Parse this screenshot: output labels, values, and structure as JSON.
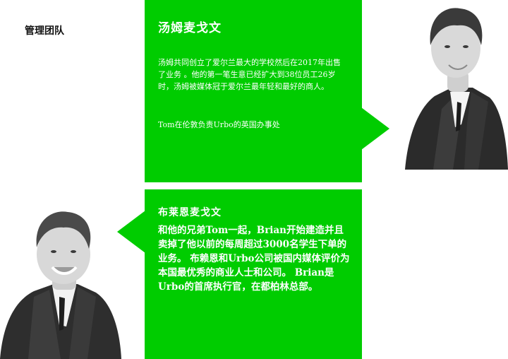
{
  "page": {
    "section_title": "管理团队"
  },
  "members": [
    {
      "name": "汤姆麦戈文",
      "bio": "汤姆共同创立了爱尔兰最大的学校然后在2017年出售了业务 。他的第一笔生意已经扩大到38位员工26岁时，汤姆被媒体冠于爱尔兰最年轻和最好的商人。",
      "note": "Tom在伦敦负责Urbo的英国办事处"
    },
    {
      "name": "布莱恩麦戈文",
      "bio": "和他的兄弟Tom一起，Brian开始建造并且卖掉了他以前的每周超过3000名学生下单的业务。 布赖恩和Urbo公司被国内媒体评价为本国最优秀的商业人士和公司。 Brian是Urbo的首席执行官，在都柏林总部。"
    }
  ],
  "colors": {
    "card_green": "#00cc00",
    "card_text": "#ffffff",
    "title_text": "#111111"
  }
}
